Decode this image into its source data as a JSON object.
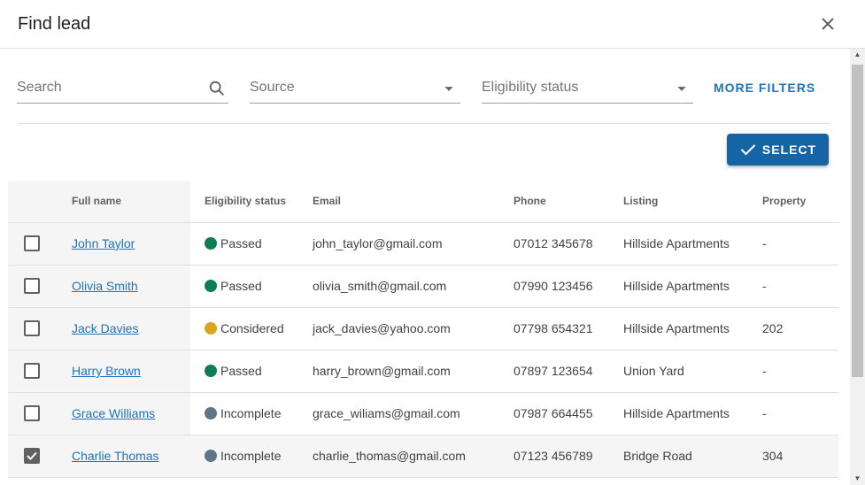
{
  "dialog": {
    "title": "Find lead",
    "close_icon": "close-icon"
  },
  "filters": {
    "search_placeholder": "Search",
    "source_placeholder": "Source",
    "eligibility_placeholder": "Eligibility status",
    "more_filters_label": "MORE FILTERS"
  },
  "actions": {
    "select_label": "SELECT"
  },
  "table": {
    "headers": {
      "full_name": "Full name",
      "eligibility": "Eligibility status",
      "email": "Email",
      "phone": "Phone",
      "listing": "Listing",
      "property": "Property"
    },
    "rows": [
      {
        "checked": false,
        "name": "John Taylor",
        "status": "Passed",
        "status_color": "#107c52",
        "email": "john_taylor@gmail.com",
        "phone": "07012 345678",
        "listing": "Hillside Apartments",
        "property": "-"
      },
      {
        "checked": false,
        "name": "Olivia Smith",
        "status": "Passed",
        "status_color": "#107c52",
        "email": "olivia_smith@gmail.com",
        "phone": "07990 123456",
        "listing": "Hillside Apartments",
        "property": "-"
      },
      {
        "checked": false,
        "name": "Jack Davies",
        "status": "Considered",
        "status_color": "#dba520",
        "email": "jack_davies@yahoo.com",
        "phone": "07798 654321",
        "listing": "Hillside Apartments",
        "property": "202"
      },
      {
        "checked": false,
        "name": "Harry Brown",
        "status": "Passed",
        "status_color": "#107c52",
        "email": "harry_brown@gmail.com",
        "phone": "07897 123654",
        "listing": "Union Yard",
        "property": "-"
      },
      {
        "checked": false,
        "name": "Grace Williams",
        "status": "Incomplete",
        "status_color": "#5f7585",
        "email": "grace_wiliams@gmail.com",
        "phone": "07987 664455",
        "listing": "Hillside Apartments",
        "property": "-"
      },
      {
        "checked": true,
        "name": "Charlie Thomas",
        "status": "Incomplete",
        "status_color": "#5f7585",
        "email": "charlie_thomas@gmail.com",
        "phone": "07123 456789",
        "listing": "Bridge Road",
        "property": "304"
      }
    ]
  },
  "colors": {
    "accent": "#1e73be",
    "button": "#1565a6"
  }
}
